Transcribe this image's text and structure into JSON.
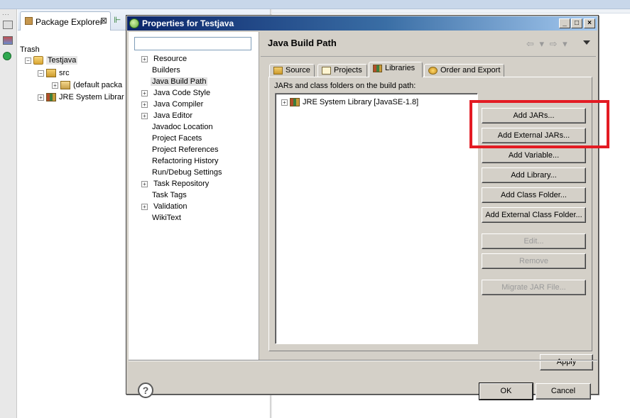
{
  "explorer": {
    "tab_label": "Package Explorer",
    "close_glyph": "⊠",
    "trash_label": "Trash",
    "tree": [
      {
        "label": "Testjava",
        "icon": "project-icon"
      },
      {
        "label": "src",
        "icon": "source-folder-icon"
      },
      {
        "label": "(default packa",
        "icon": "package-icon"
      },
      {
        "label": "JRE System Librar",
        "icon": "library-icon"
      }
    ],
    "expand_glyph": "+",
    "collapse_glyph": "−"
  },
  "dialog": {
    "title": "Properties for Testjava",
    "minimize_glyph": "_",
    "maximize_glyph": "□",
    "close_glyph": "×",
    "nav": [
      {
        "label": "Resource",
        "expandable": true
      },
      {
        "label": "Builders",
        "expandable": false
      },
      {
        "label": "Java Build Path",
        "expandable": false,
        "selected": true
      },
      {
        "label": "Java Code Style",
        "expandable": true
      },
      {
        "label": "Java Compiler",
        "expandable": true
      },
      {
        "label": "Java Editor",
        "expandable": true
      },
      {
        "label": "Javadoc Location",
        "expandable": false
      },
      {
        "label": "Project Facets",
        "expandable": false
      },
      {
        "label": "Project References",
        "expandable": false
      },
      {
        "label": "Refactoring History",
        "expandable": false
      },
      {
        "label": "Run/Debug Settings",
        "expandable": false
      },
      {
        "label": "Task Repository",
        "expandable": true
      },
      {
        "label": "Task Tags",
        "expandable": false
      },
      {
        "label": "Validation",
        "expandable": true
      },
      {
        "label": "WikiText",
        "expandable": false
      }
    ],
    "page_title": "Java Build Path",
    "nav_arrows": "⇦ ▾ ⇨ ▾",
    "tabs": [
      {
        "label": "Source",
        "icon": "source-icon"
      },
      {
        "label": "Projects",
        "icon": "projects-icon"
      },
      {
        "label": "Libraries",
        "icon": "libraries-icon",
        "active": true
      },
      {
        "label": "Order and Export",
        "icon": "order-export-icon"
      }
    ],
    "libraries_caption": "JARs and class folders on the build path:",
    "libraries": [
      {
        "label": "JRE System Library [JavaSE-1.8]",
        "icon": "library-icon"
      }
    ],
    "buttons": [
      {
        "label": "Add JARs...",
        "enabled": true
      },
      {
        "label": "Add External JARs...",
        "enabled": true
      },
      {
        "label": "Add Variable...",
        "enabled": true
      },
      {
        "label": "Add Library...",
        "enabled": true
      },
      {
        "label": "Add Class Folder...",
        "enabled": true
      },
      {
        "label": "Add External Class Folder...",
        "enabled": true
      },
      {
        "label": "Edit...",
        "enabled": false
      },
      {
        "label": "Remove",
        "enabled": false
      },
      {
        "label": "Migrate JAR File...",
        "enabled": false
      }
    ],
    "apply_label": "Apply",
    "ok_label": "OK",
    "cancel_label": "Cancel",
    "help_glyph": "?",
    "highlight_color": "#e31b23"
  }
}
